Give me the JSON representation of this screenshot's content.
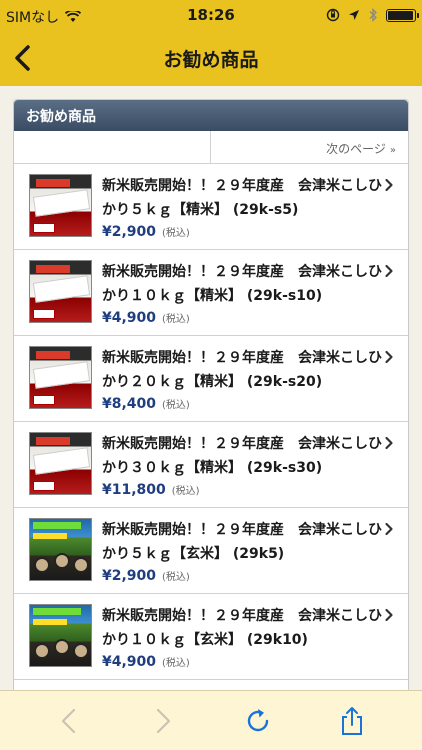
{
  "status_bar": {
    "carrier": "SIMなし",
    "time": "18:26",
    "battery_level": 0.95,
    "icons": [
      "wifi-icon",
      "orientation-lock-icon",
      "location-icon",
      "bluetooth-icon",
      "battery-icon"
    ]
  },
  "nav": {
    "title": "お勧め商品",
    "back_icon": "chevron-left-icon"
  },
  "panel": {
    "header": "お勧め商品",
    "next_page": "次のページ",
    "next_chevron": "»"
  },
  "items": [
    {
      "title": "新米販売開始！！２９年度産　会津米こしひかり５ｋｇ【精米】 (29k-s5)",
      "price": "¥2,900",
      "tax": "(税込)",
      "thumb": "white"
    },
    {
      "title": "新米販売開始！！２９年度産　会津米こしひかり１０ｋｇ【精米】 (29k-s10)",
      "price": "¥4,900",
      "tax": "(税込)",
      "thumb": "white"
    },
    {
      "title": "新米販売開始！！２９年度産　会津米こしひかり２０ｋｇ【精米】 (29k-s20)",
      "price": "¥8,400",
      "tax": "(税込)",
      "thumb": "white"
    },
    {
      "title": "新米販売開始！！２９年度産　会津米こしひかり３０ｋｇ【精米】 (29k-s30)",
      "price": "¥11,800",
      "tax": "(税込)",
      "thumb": "white"
    },
    {
      "title": "新米販売開始！！２９年度産　会津米こしひかり５ｋｇ【玄米】 (29k5)",
      "price": "¥2,900",
      "tax": "(税込)",
      "thumb": "brown"
    },
    {
      "title": "新米販売開始！！２９年度産　会津米こしひかり１０ｋｇ【玄米】 (29k10)",
      "price": "¥4,900",
      "tax": "(税込)",
      "thumb": "brown"
    }
  ],
  "toolbar": {
    "buttons": [
      "back-arrow-icon",
      "forward-arrow-icon",
      "reload-icon",
      "share-icon"
    ]
  },
  "colors": {
    "brand_yellow": "#e9c21f",
    "header_navy": "#3a4c63",
    "price_blue": "#1f3e80",
    "toolbar_blue": "#1a73d9",
    "toolbar_bg": "#fdf5d3"
  }
}
